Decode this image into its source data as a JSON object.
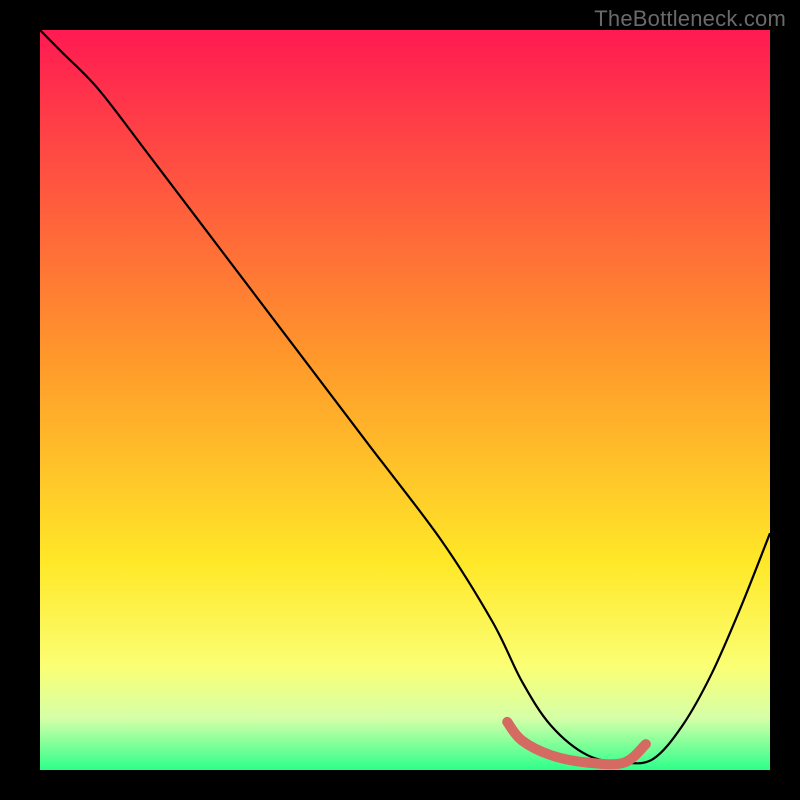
{
  "watermark": "TheBottleneck.com",
  "chart_data": {
    "type": "line",
    "title": "",
    "xlabel": "",
    "ylabel": "",
    "xlim": [
      0,
      100
    ],
    "ylim": [
      0,
      100
    ],
    "background_gradient": {
      "stops": [
        {
          "offset": 0.0,
          "color": "#ff1a52"
        },
        {
          "offset": 0.45,
          "color": "#ff9a2a"
        },
        {
          "offset": 0.72,
          "color": "#ffe828"
        },
        {
          "offset": 0.86,
          "color": "#fbff74"
        },
        {
          "offset": 0.93,
          "color": "#d5ffa8"
        },
        {
          "offset": 1.0,
          "color": "#2dff8a"
        }
      ]
    },
    "series": [
      {
        "name": "curve",
        "color": "#000000",
        "x": [
          0,
          3,
          8,
          15,
          25,
          35,
          45,
          55,
          62,
          66,
          70,
          75,
          80,
          84,
          88,
          92,
          96,
          100
        ],
        "values": [
          100,
          97,
          92,
          83,
          70,
          57,
          44,
          31,
          20,
          12,
          6,
          2,
          1,
          1.5,
          6,
          13,
          22,
          32
        ]
      }
    ],
    "highlight": {
      "name": "flat-region",
      "color": "#d46a62",
      "x": [
        64,
        66,
        70,
        75,
        80,
        83
      ],
      "values": [
        6.5,
        4,
        2,
        1,
        1,
        3.5
      ]
    }
  }
}
